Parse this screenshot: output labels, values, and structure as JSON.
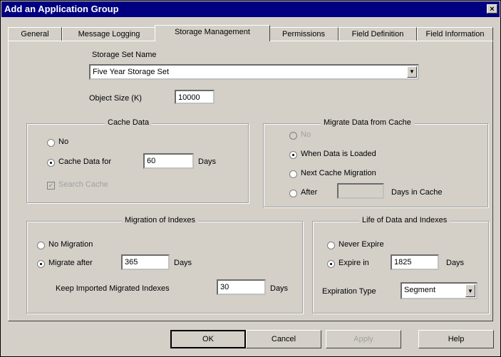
{
  "window": {
    "title": "Add an Application Group",
    "close": "×"
  },
  "tabs": [
    "General",
    "Message Logging",
    "Storage Management",
    "Permissions",
    "Field Definition",
    "Field Information"
  ],
  "storage": {
    "label": "Storage Set Name",
    "value": "Five Year Storage Set",
    "arrow": "▼"
  },
  "object_size": {
    "label": "Object Size (K)",
    "value": "10000"
  },
  "cache_data": {
    "title": "Cache Data",
    "no": "No",
    "cache_for": "Cache Data for",
    "cache_value": "60",
    "days": "Days",
    "search_cache": "Search Cache"
  },
  "migrate_cache": {
    "title": "Migrate Data from Cache",
    "no": "No",
    "when_loaded": "When Data is Loaded",
    "next_migration": "Next Cache Migration",
    "after": "After",
    "after_value": "",
    "days_in_cache": "Days in Cache"
  },
  "migration_indexes": {
    "title": "Migration of Indexes",
    "no_migration": "No Migration",
    "migrate_after": "Migrate after",
    "migrate_value": "365",
    "days": "Days",
    "keep_label": "Keep Imported Migrated Indexes",
    "keep_value": "30",
    "keep_days": "Days"
  },
  "life": {
    "title": "Life of Data and Indexes",
    "never": "Never Expire",
    "expire_in": "Expire in",
    "expire_value": "1825",
    "days": "Days",
    "type_label": "Expiration Type",
    "type_value": "Segment",
    "arrow": "▼"
  },
  "buttons": {
    "ok": "OK",
    "cancel": "Cancel",
    "apply": "Apply",
    "help": "Help"
  }
}
